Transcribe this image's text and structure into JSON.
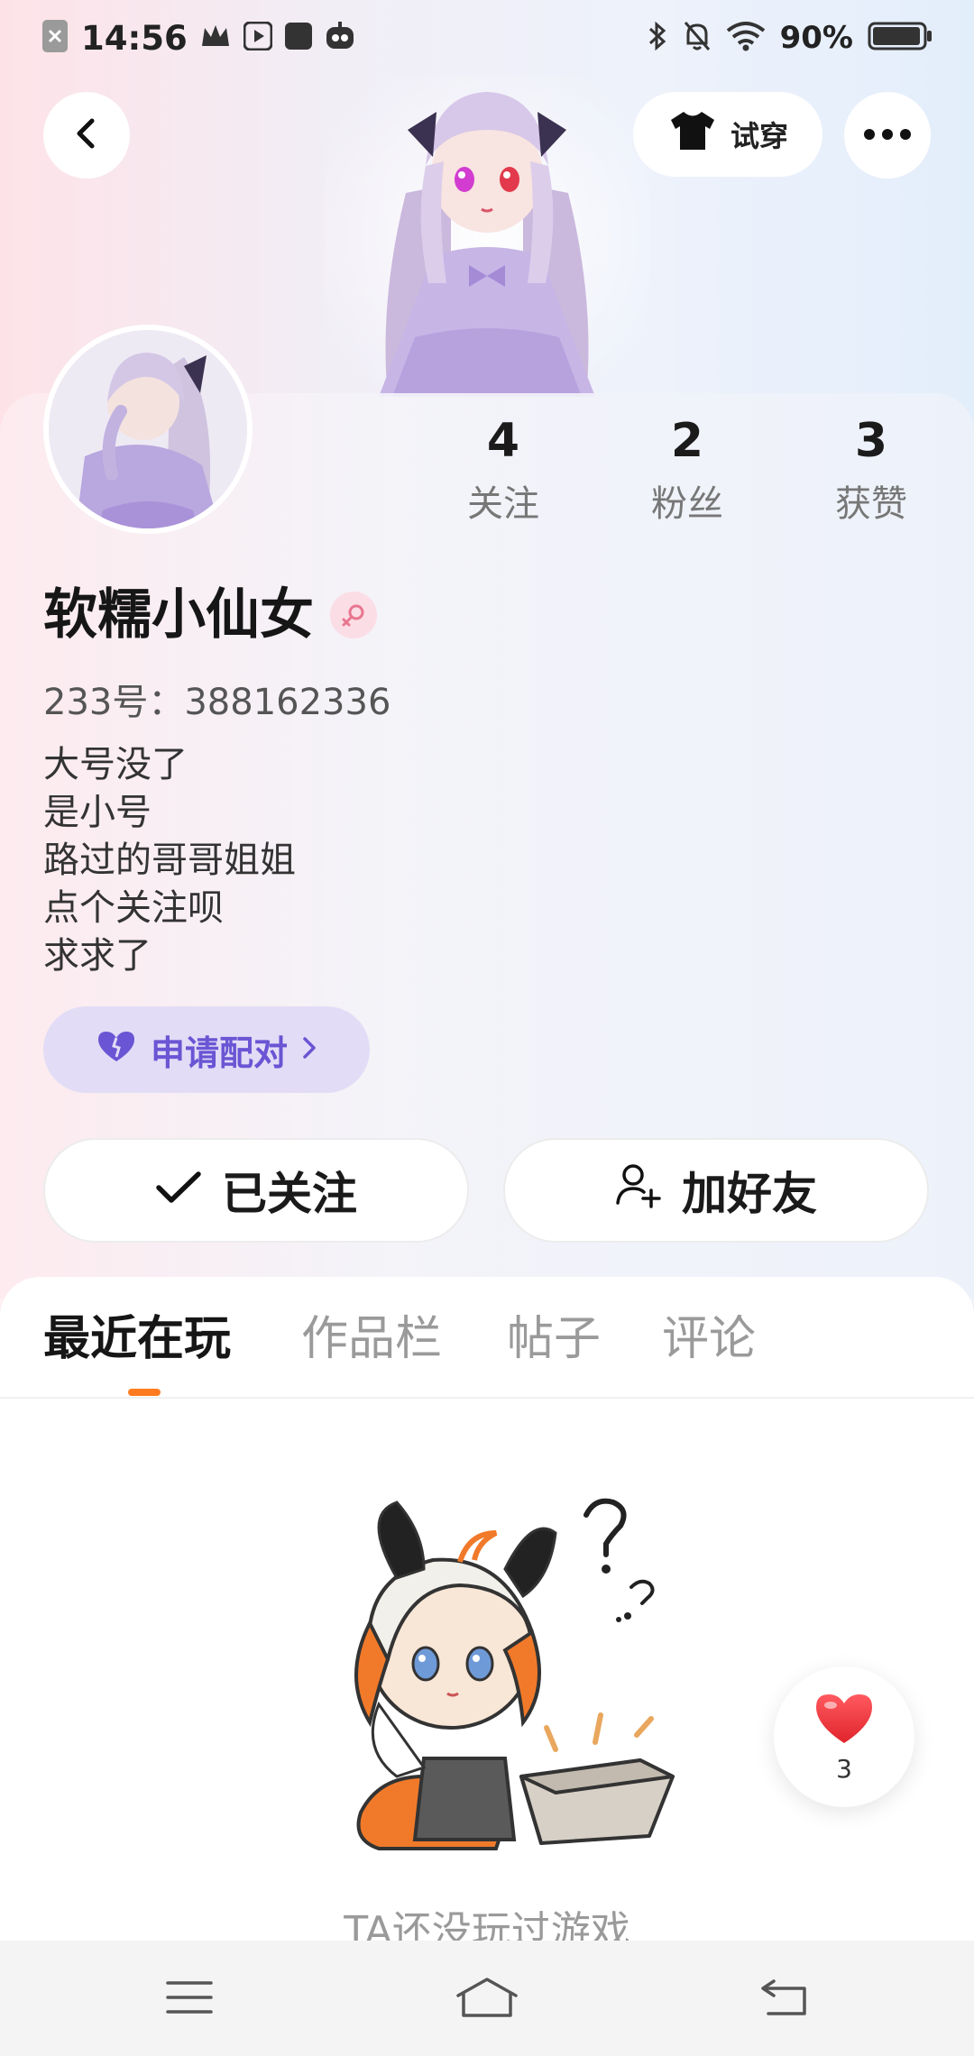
{
  "status_bar": {
    "time": "14:56",
    "battery": "90%"
  },
  "header": {
    "try_on_label": "试穿",
    "icons": [
      "back-arrow-icon",
      "tshirt-icon",
      "more-dots-icon"
    ]
  },
  "profile": {
    "nickname": "软糯小仙女",
    "gender": "female",
    "user_id": "233号：388162336",
    "stats": [
      {
        "value": "4",
        "label": "关注"
      },
      {
        "value": "2",
        "label": "粉丝"
      },
      {
        "value": "3",
        "label": "获赞"
      }
    ],
    "bio": [
      "大号没了",
      "是小号",
      "路过的哥哥姐姐",
      "点个关注呗",
      "求求了"
    ],
    "pair_label": "申请配对"
  },
  "actions": {
    "followed_label": "已关注",
    "add_friend_label": "加好友"
  },
  "tabs": [
    {
      "label": "最近在玩",
      "active": true
    },
    {
      "label": "作品栏",
      "active": false
    },
    {
      "label": "帖子",
      "active": false
    },
    {
      "label": "评论",
      "active": false
    }
  ],
  "empty_state": {
    "text": "TA还没玩过游戏"
  },
  "like_float": {
    "count": "3"
  },
  "colors": {
    "accent_orange": "#ff7b1f",
    "pair_purple": "#6a55d4",
    "pair_bg": "#e2dcf6",
    "heart_red": "#f0393f"
  }
}
